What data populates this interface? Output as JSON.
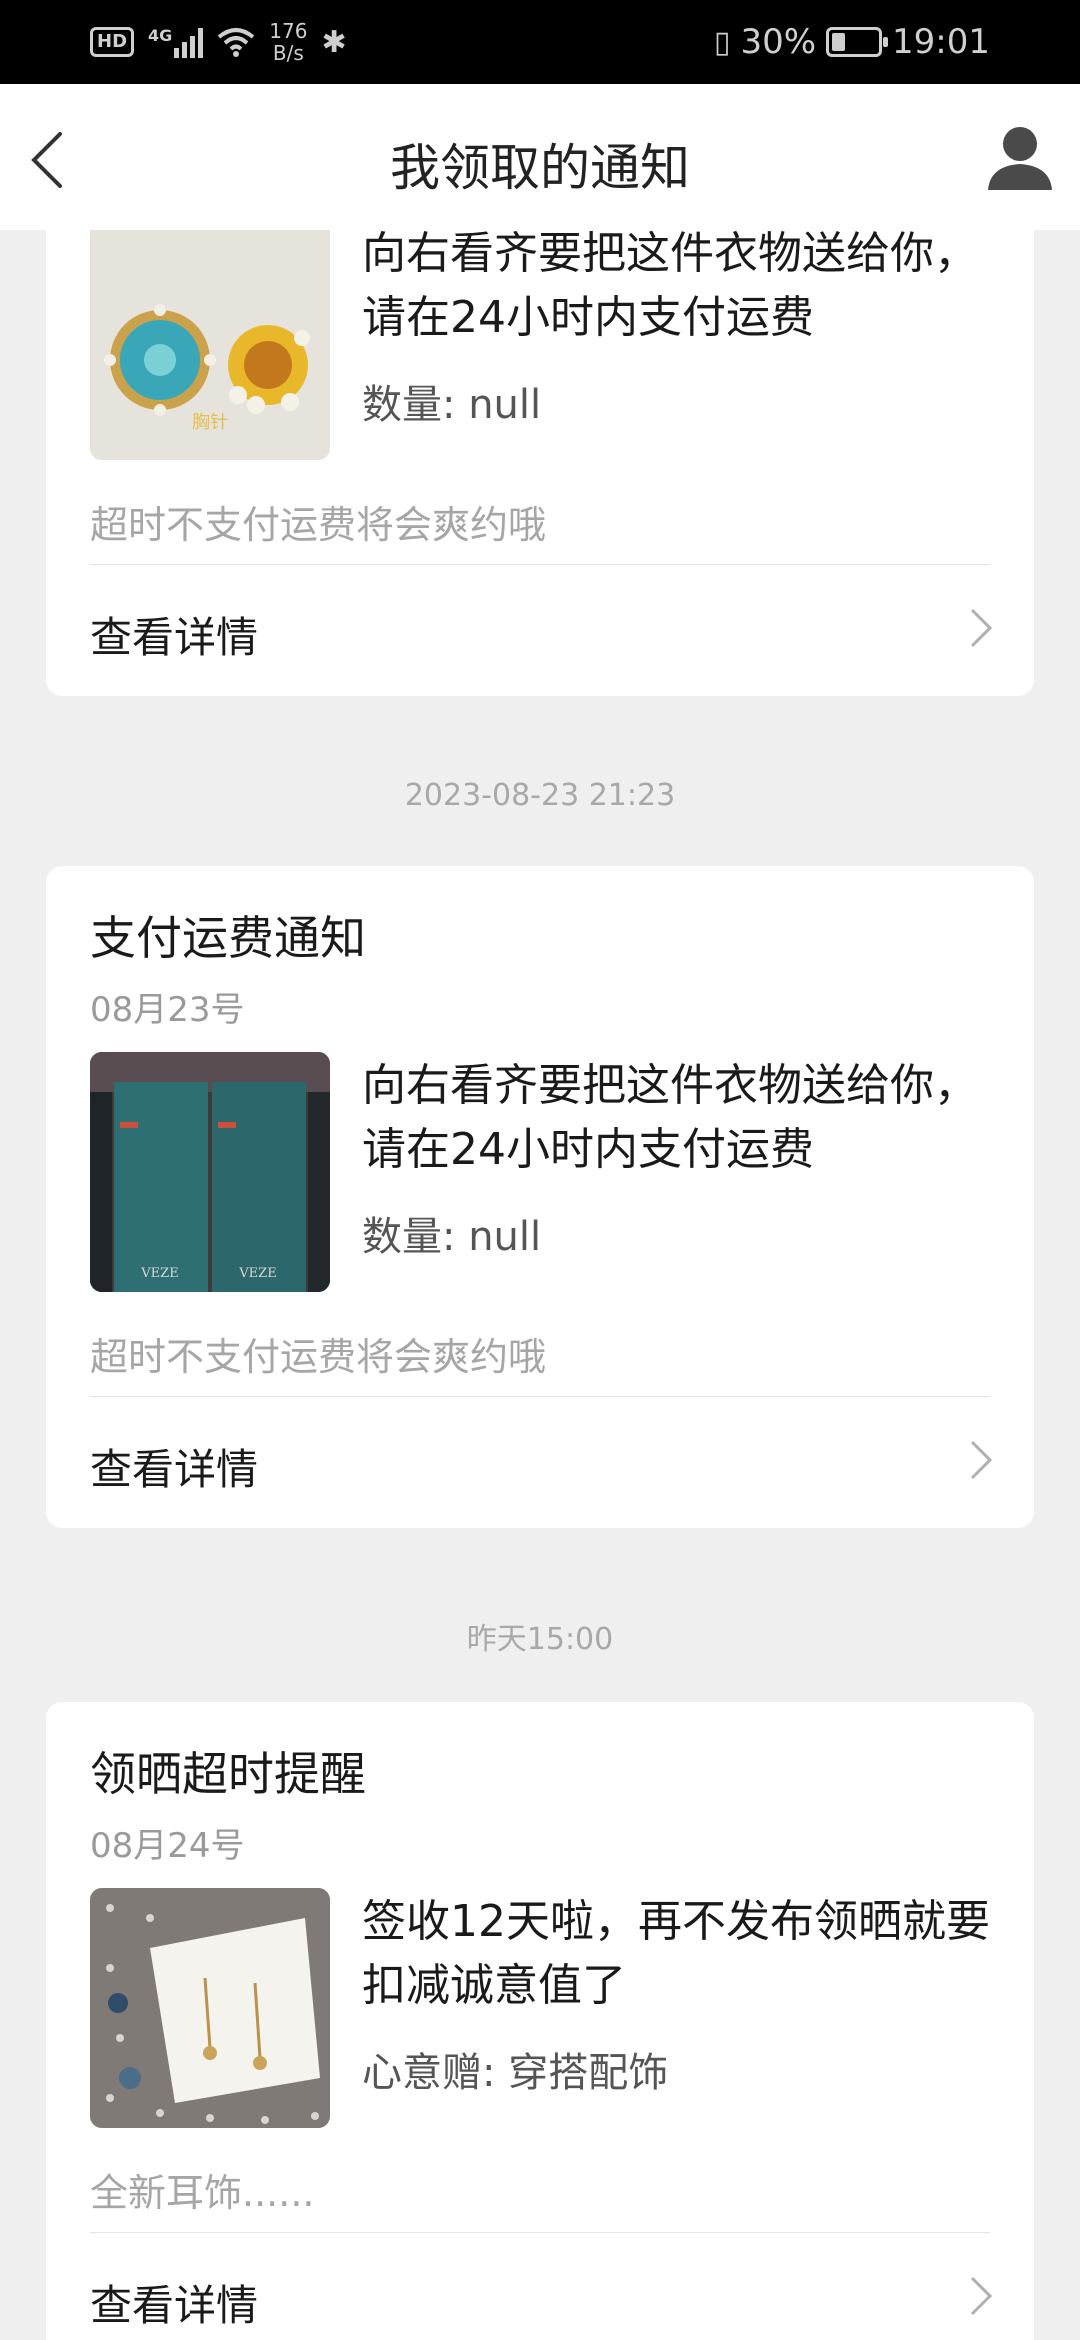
{
  "status_bar": {
    "hd": "HD",
    "network": "4G",
    "speed_value": "176",
    "speed_unit": "B/s",
    "battery": "30%",
    "battery_level": 0.3,
    "time": "19:01"
  },
  "nav": {
    "title": "我领取的通知"
  },
  "cards": [
    {
      "message": "向右看齐要把这件衣物送给你，请在24小时内支付运费",
      "qty": "数量: null",
      "note": "超时不支付运费将会爽约哦",
      "detail_label": "查看详情",
      "thumb_label": "胸针"
    },
    {
      "title": "支付运费通知",
      "date": "08月23号",
      "message": "向右看齐要把这件衣物送给你，请在24小时内支付运费",
      "qty": "数量: null",
      "note": "超时不支付运费将会爽约哦",
      "detail_label": "查看详情",
      "thumb_label": "VEZE"
    },
    {
      "title": "领晒超时提醒",
      "date": "08月24号",
      "message": "签收12天啦，再不发布领晒就要扣减诚意值了",
      "qty": "心意赠: 穿搭配饰",
      "note": "全新耳饰......",
      "detail_label": "查看详情"
    }
  ],
  "separators": [
    "2023-08-23 21:23",
    "昨天15:00"
  ],
  "colors": {
    "background": "#efefef",
    "card": "#ffffff",
    "muted_text": "#9a9a9a"
  }
}
